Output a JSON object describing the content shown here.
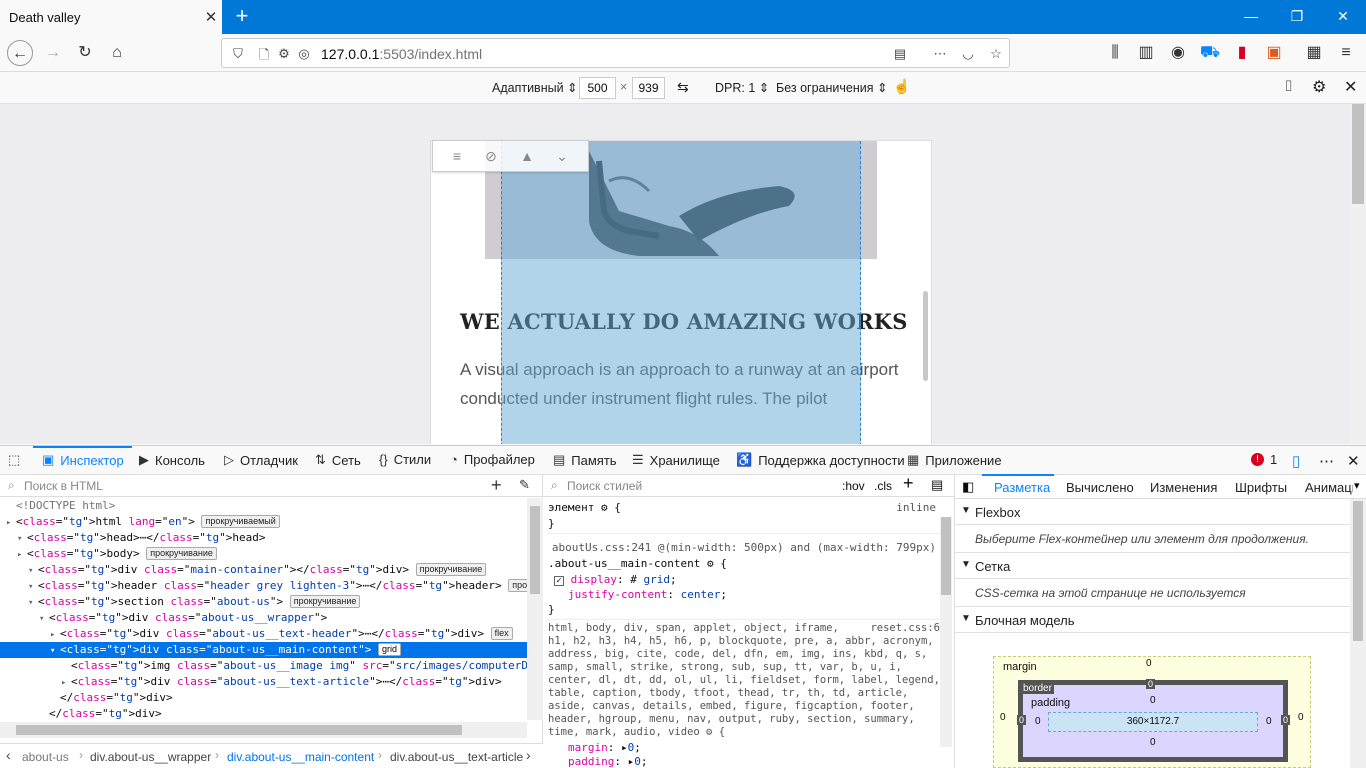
{
  "browser": {
    "tab_title": "Death valley",
    "url_host": "127.0.0.1",
    "url_rest": ":5503/index.html"
  },
  "rdm": {
    "device": "Адаптивный",
    "width": "500",
    "x": "×",
    "height": "939",
    "dpr": "DPR: 1",
    "throttle": "Без ограничения"
  },
  "page": {
    "heading": "WE ACTUALLY DO AMAZING WORKS",
    "para1": "A visual approach is an approach to a runway at an airport",
    "para2": "conducted under instrument flight rules. The pilot"
  },
  "devtools": {
    "tabs": [
      "Инспектор",
      "Консоль",
      "Отладчик",
      "Сеть",
      "Стили",
      "Профайлер",
      "Память",
      "Хранилище",
      "Поддержка доступности",
      "Приложение"
    ],
    "error_count": "1"
  },
  "html_panel": {
    "search_placeholder": "Поиск в HTML",
    "lines": [
      {
        "i": 0,
        "t": "<!DOCTYPE html>"
      },
      {
        "i": 0,
        "t": "<html lang=\"en\">",
        "b": "прокручиваемый"
      },
      {
        "i": 1,
        "t": "<head>⋯</head>"
      },
      {
        "i": 1,
        "t": "<body>",
        "b": "прокручивание"
      },
      {
        "i": 2,
        "t": "<div class=\"main-container\"></div>",
        "b": "прокручивание"
      },
      {
        "i": 2,
        "t": "<header class=\"header grey lighten-3\">⋯</header>",
        "b": "прокручивание"
      },
      {
        "i": 2,
        "t": "<section class=\"about-us\">",
        "b": "прокручивание"
      },
      {
        "i": 3,
        "t": "<div class=\"about-us__wrapper\">"
      },
      {
        "i": 4,
        "t": "<div class=\"about-us__text-header\">⋯</div>",
        "b": "flex"
      },
      {
        "i": 4,
        "t": "<div class=\"about-us__main-content\">",
        "b": "grid",
        "sel": true
      },
      {
        "i": 5,
        "t": "<img class=\"about-us__image img\" src=\"src/images/computerDesk.png\" alt=\"\">"
      },
      {
        "i": 5,
        "t": "<div class=\"about-us__text-article\">⋯</div>"
      },
      {
        "i": 4,
        "t": "</div>"
      },
      {
        "i": 3,
        "t": "</div>"
      }
    ],
    "breadcrumbs": [
      "about-us",
      "div.about-us__wrapper",
      "div.about-us__main-content",
      "div.about-us__text-article"
    ]
  },
  "styles_panel": {
    "search_placeholder": "Поиск стилей",
    "hov": ":hov",
    "cls": ".cls",
    "element_rule": "элемент",
    "inline": "inline",
    "media": "aboutUs.css:241 @(min-width: 500px) and (max-width: 799px)",
    "selector": ".about-us__main-content",
    "decl1_prop": "display",
    "decl1_val": "grid",
    "decl2_prop": "justify-content",
    "decl2_val": "center",
    "reset_src": "reset.css:6",
    "reset_selectors": "html, body, div, span, applet, object, iframe, h1, h2, h3, h4, h5, h6, p, blockquote, pre, a, abbr, acronym, address, big, cite, code, del, dfn, em, img, ins, kbd, q, s, samp, small, strike, strong, sub, sup, tt, var, b, u, i, center, dl, dt, dd, ol, ul, li, fieldset, form, label, legend, table, caption, tbody, tfoot, thead, tr, th, td, article, aside, canvas, details, embed, figure, figcaption, footer, header, hgroup, menu, nav, output, ruby, section, summary, time, mark, audio, video",
    "r_margin": "margin",
    "r_padding": "padding",
    "r_border": "border",
    "r_zero": "0"
  },
  "layout_panel": {
    "tabs": [
      "Разметка",
      "Вычислено",
      "Изменения",
      "Шрифты",
      "Анимации"
    ],
    "flexbox": "Flexbox",
    "flex_hint": "Выберите Flex-контейнер или элемент для продолжения.",
    "grid": "Сетка",
    "grid_hint": "CSS-сетка на этой странице не используется",
    "boxmodel": "Блочная модель",
    "margin": "margin",
    "border": "border",
    "padding": "padding",
    "size": "360×1172.7",
    "zero": "0"
  }
}
